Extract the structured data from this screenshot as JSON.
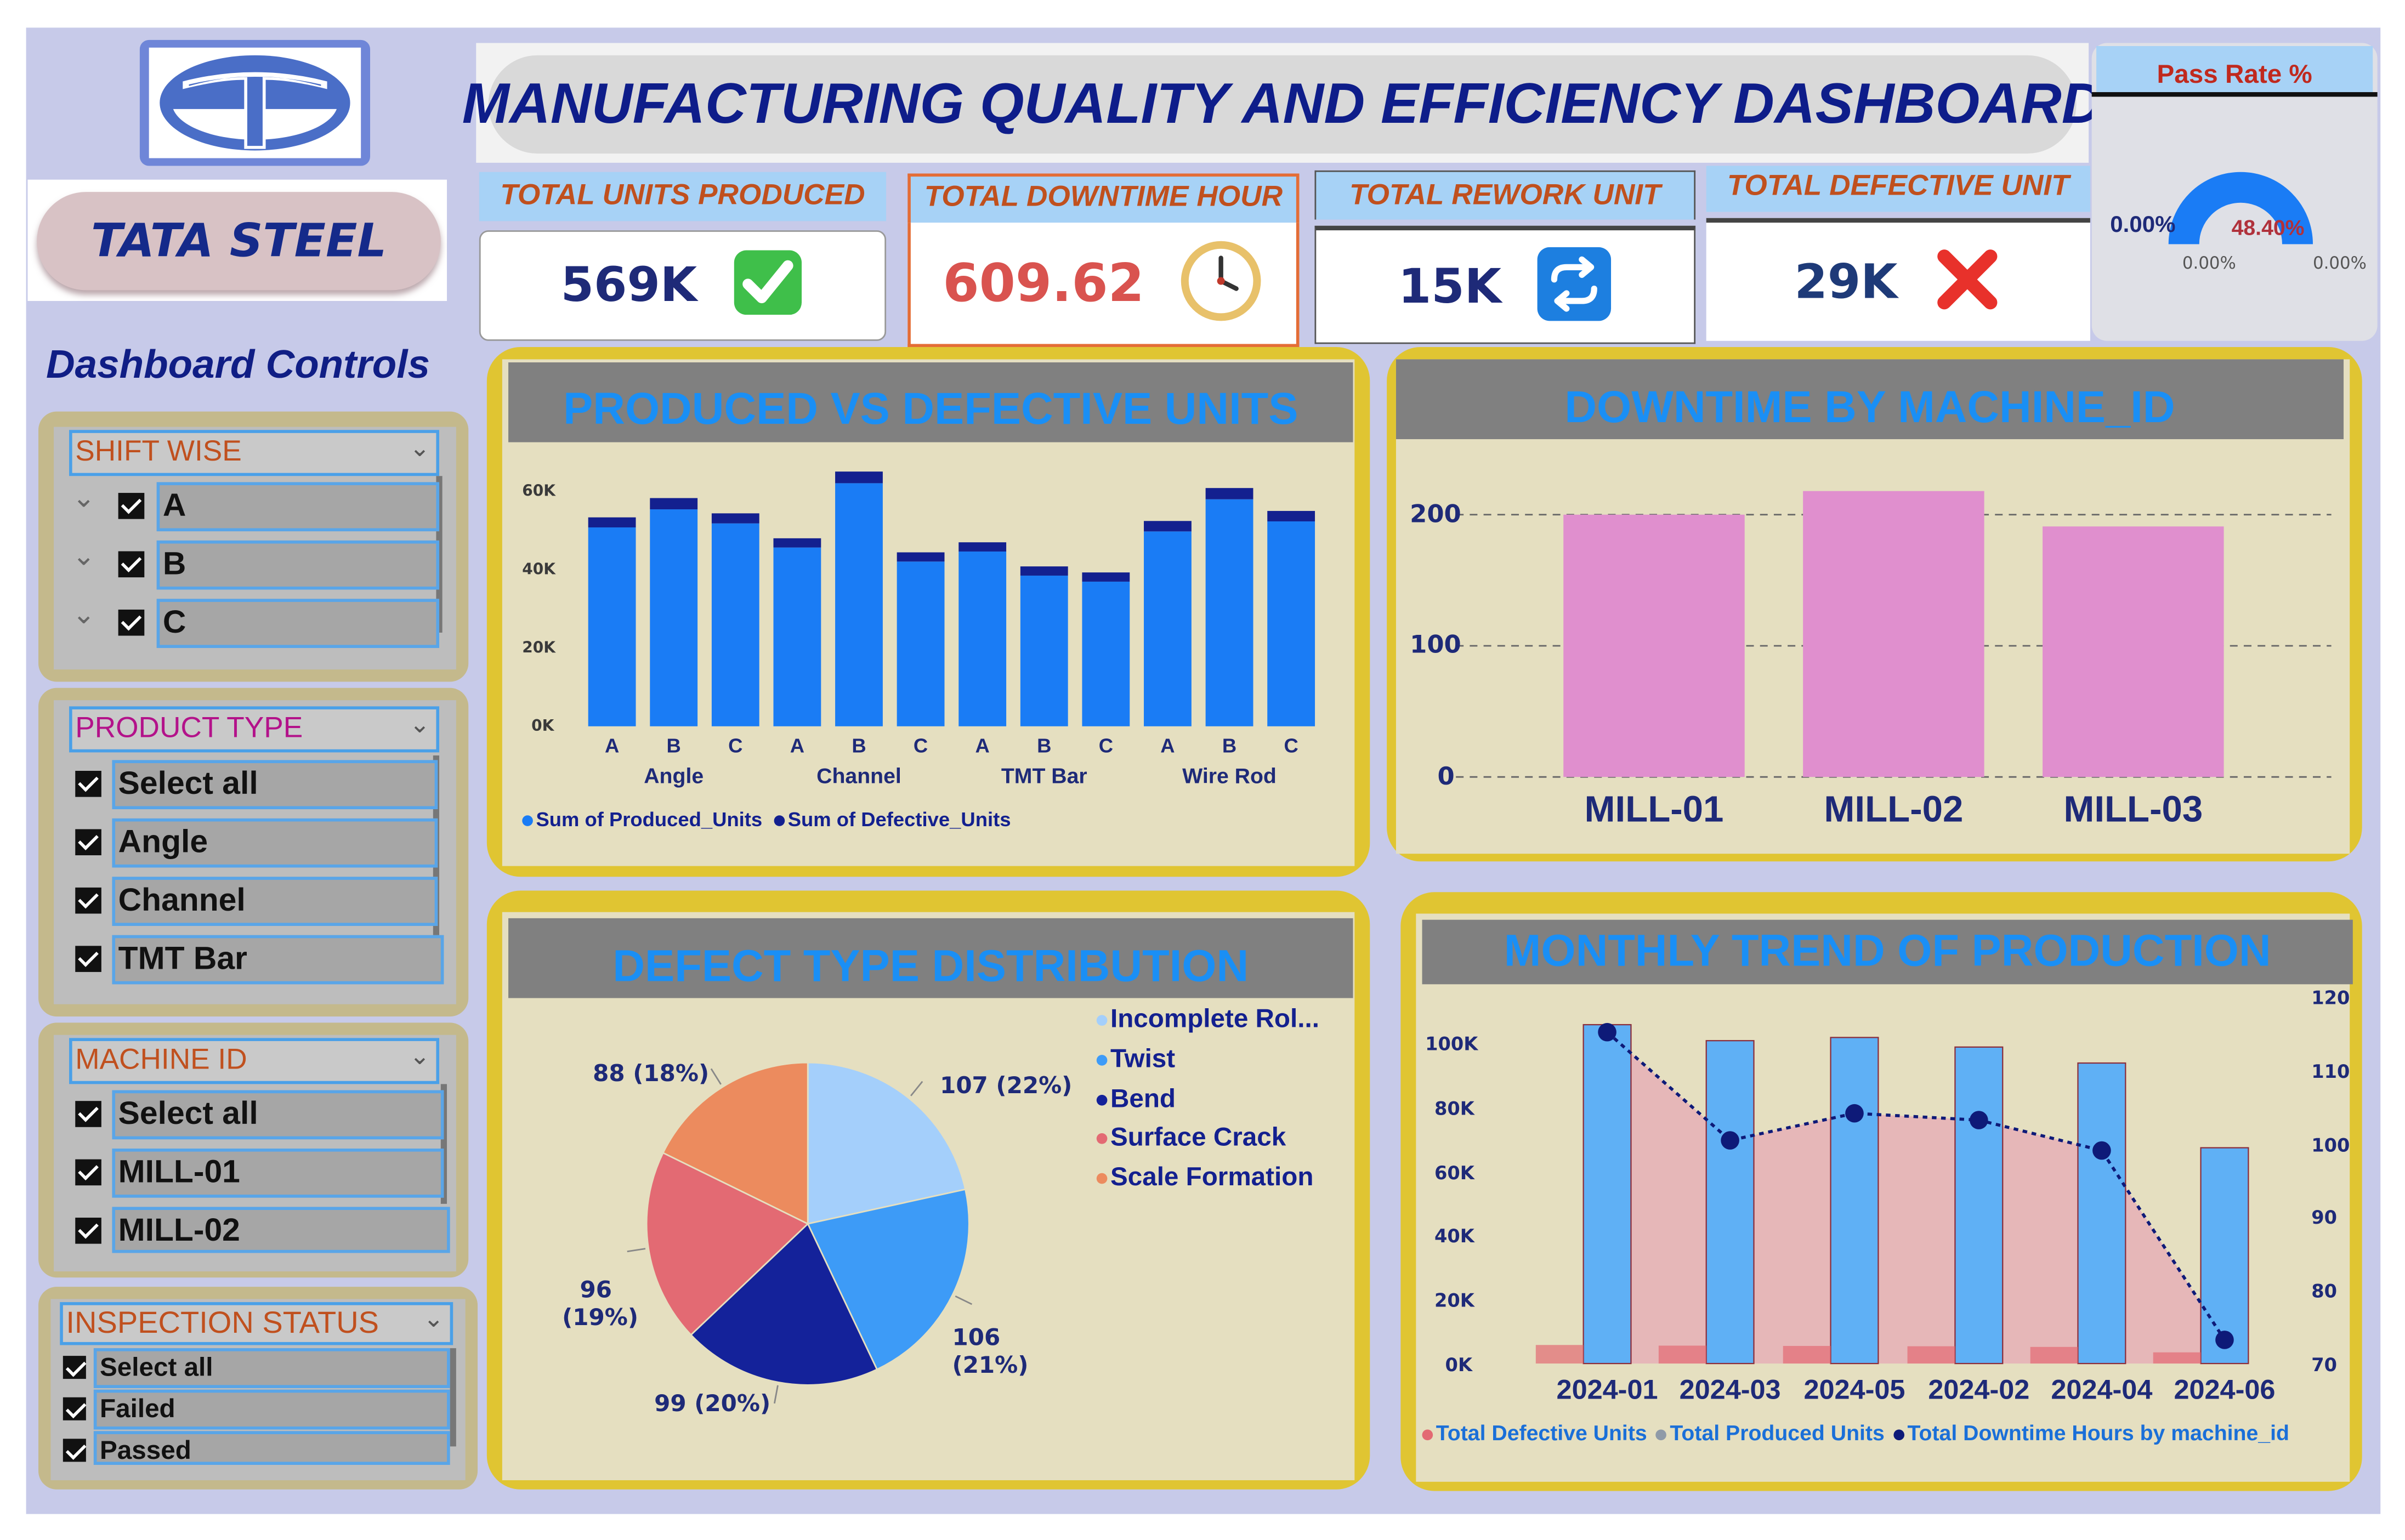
{
  "brand": {
    "name": "TATA STEEL"
  },
  "controls": {
    "title": "Dashboard Controls"
  },
  "slicers": {
    "shift": {
      "label": "SHIFT WISE",
      "options": [
        "A",
        "B",
        "C"
      ]
    },
    "product": {
      "label": "PRODUCT TYPE",
      "options": [
        "Select all",
        "Angle",
        "Channel",
        "TMT Bar"
      ]
    },
    "machine": {
      "label": "MACHINE ID",
      "options": [
        "Select all",
        "MILL-01",
        "MILL-02"
      ]
    },
    "inspection": {
      "label": "INSPECTION STATUS",
      "options": [
        "Select all",
        "Failed",
        "Passed"
      ]
    }
  },
  "header": {
    "title": "MANUFACTURING QUALITY AND EFFICIENCY DASHBOARD"
  },
  "kpis": [
    {
      "label": "TOTAL UNITS PRODUCED",
      "value": "569K",
      "icon": "check-mark-icon",
      "color": "#1e2a78"
    },
    {
      "label": "TOTAL DOWNTIME HOUR",
      "value": "609.62",
      "icon": "clock-icon",
      "color": "#d9534f"
    },
    {
      "label": "TOTAL REWORK UNIT",
      "value": "15K",
      "icon": "repeat-icon",
      "color": "#1e2a78"
    },
    {
      "label": "TOTAL DEFECTIVE UNIT",
      "value": "29K",
      "icon": "cross-mark-icon",
      "color": "#1e3a78"
    }
  ],
  "gauge": {
    "title": "Pass Rate %",
    "value": "48.40%",
    "min": "0.00%",
    "max": "0.00%",
    "target": "0.00%",
    "fill_fraction": 1.0
  },
  "colors": {
    "produced": "#1a7cf5",
    "defective": "#13208f",
    "downtime_bar": "#e08fce",
    "trend_bar": "#5fb0f5",
    "trend_area": "#e6a9b5",
    "trend_line": "#0e1a78"
  },
  "charts": {
    "produced_vs_defective": {
      "title": "PRODUCED VS DEFECTIVE UNITS",
      "y_ticks": [
        "60K",
        "40K",
        "20K",
        "0K"
      ],
      "legend": [
        "Sum of Produced_Units",
        "Sum of Defective_Units"
      ]
    },
    "downtime": {
      "title": "DOWNTIME BY MACHINE_ID",
      "y_ticks": [
        "200",
        "100",
        "0"
      ]
    },
    "defect_type": {
      "title": "DEFECT TYPE DISTRIBUTION",
      "legend": [
        "Incomplete Rol...",
        "Twist",
        "Bend",
        "Surface Crack",
        "Scale Formation"
      ],
      "labels": [
        "107 (22%)",
        "106 (21%)",
        "99 (20%)",
        "96 (19%)",
        "88 (18%)"
      ]
    },
    "monthly": {
      "title": "MONTHLY TREND OF PRODUCTION",
      "y_left_ticks": [
        "100K",
        "80K",
        "60K",
        "40K",
        "20K",
        "0K"
      ],
      "y_right_ticks": [
        "120",
        "110",
        "100",
        "90",
        "80",
        "70"
      ],
      "legend": [
        "Total Defective Units",
        "Total Produced Units",
        "Total Downtime Hours by machine_id"
      ]
    }
  },
  "chart_data": [
    {
      "type": "bar",
      "title": "PRODUCED VS DEFECTIVE UNITS",
      "group_labels": [
        "Angle",
        "Channel",
        "TMT Bar",
        "Wire Rod"
      ],
      "categories": [
        "A",
        "B",
        "C",
        "A",
        "B",
        "C",
        "A",
        "B",
        "C",
        "A",
        "B",
        "C"
      ],
      "ylim": [
        0,
        60000
      ],
      "series": [
        {
          "name": "Sum of Produced_Units",
          "values": [
            49500,
            54000,
            50500,
            44500,
            60500,
            41000,
            43500,
            37500,
            36000,
            48500,
            56500,
            51000
          ]
        },
        {
          "name": "Sum of Defective_Units",
          "values": [
            2500,
            2800,
            2500,
            2200,
            2900,
            2100,
            2100,
            1900,
            1700,
            2600,
            2800,
            2600
          ]
        }
      ]
    },
    {
      "type": "bar",
      "title": "DOWNTIME BY MACHINE_ID",
      "categories": [
        "MILL-01",
        "MILL-02",
        "MILL-03"
      ],
      "values": [
        200,
        218,
        191
      ],
      "ylim": [
        0,
        240
      ]
    },
    {
      "type": "pie",
      "title": "DEFECT TYPE DISTRIBUTION",
      "categories": [
        "Incomplete Rol...",
        "Twist",
        "Bend",
        "Surface Crack",
        "Scale Formation"
      ],
      "values": [
        107,
        106,
        99,
        96,
        88
      ],
      "percents": [
        22,
        21,
        20,
        19,
        18
      ]
    },
    {
      "type": "bar",
      "title": "MONTHLY TREND OF PRODUCTION",
      "categories": [
        "2024-01",
        "2024-03",
        "2024-05",
        "2024-02",
        "2024-04",
        "2024-06"
      ],
      "ylim": [
        0,
        110000
      ],
      "y2lim": [
        70,
        122
      ],
      "series": [
        {
          "name": "Total Defective Units",
          "values": [
            5800,
            5600,
            5500,
            5400,
            5200,
            3500
          ]
        },
        {
          "name": "Total Produced Units",
          "values": [
            106000,
            101000,
            102000,
            99000,
            94000,
            67500
          ]
        },
        {
          "name": "Total Downtime Hours by machine_id",
          "values": [
            119,
            103,
            107,
            106,
            101.5,
            73.5
          ]
        }
      ]
    }
  ]
}
